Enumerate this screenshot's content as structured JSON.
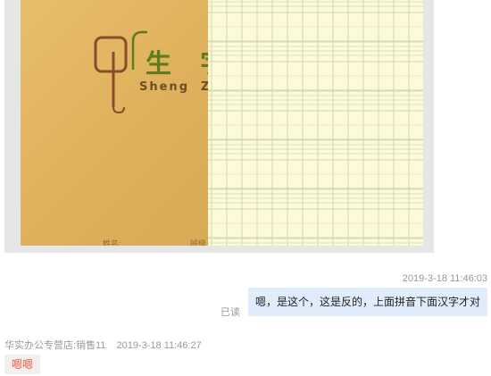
{
  "image_message": {
    "cover": {
      "title": "生 字",
      "pinyin": "Sheng  Zi",
      "name_label": "姓名:",
      "class_label": "班级"
    }
  },
  "outgoing": {
    "timestamp": "2019-3-18 11:46:03",
    "read_status": "已读",
    "text": "嗯，是这个，这是反的，上面拼音下面汉字才对"
  },
  "incoming": {
    "sender": "华实办公专营店:销售11",
    "timestamp": "2019-3-18 11:46:27",
    "text": "嗯嗯"
  },
  "colors": {
    "outgoing_bubble": "#e1ecfb",
    "incoming_text": "#e45c4a",
    "grid_line": "#cfd9a8"
  }
}
